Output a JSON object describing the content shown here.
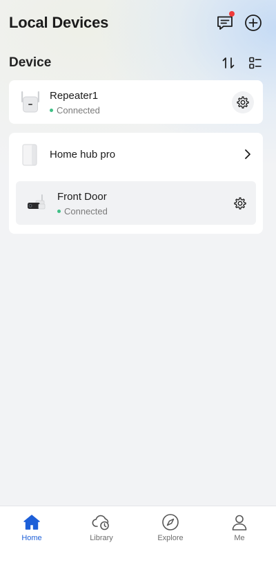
{
  "header": {
    "title": "Local Devices",
    "message_icon": "message-icon",
    "add_icon": "add-circle-icon",
    "has_unread": true
  },
  "section": {
    "title": "Device",
    "sort_icon": "sort-icon",
    "view_icon": "grid-view-icon"
  },
  "devices": [
    {
      "name": "Repeater1",
      "status": "Connected",
      "icon": "repeater-device-image"
    }
  ],
  "hub": {
    "name": "Home hub pro",
    "icon": "hub-device-image",
    "children": [
      {
        "name": "Front Door",
        "status": "Connected",
        "icon": "camera-device-image"
      }
    ]
  },
  "tabs": [
    {
      "label": "Home",
      "icon": "home-icon",
      "active": true
    },
    {
      "label": "Library",
      "icon": "cloud-clock-icon",
      "active": false
    },
    {
      "label": "Explore",
      "icon": "compass-icon",
      "active": false
    },
    {
      "label": "Me",
      "icon": "user-icon",
      "active": false
    }
  ],
  "colors": {
    "accent": "#1d5fd8",
    "status_connected": "#3fbf86",
    "badge": "#f03a3a",
    "card": "#ffffff",
    "background": "#f2f3f5"
  }
}
